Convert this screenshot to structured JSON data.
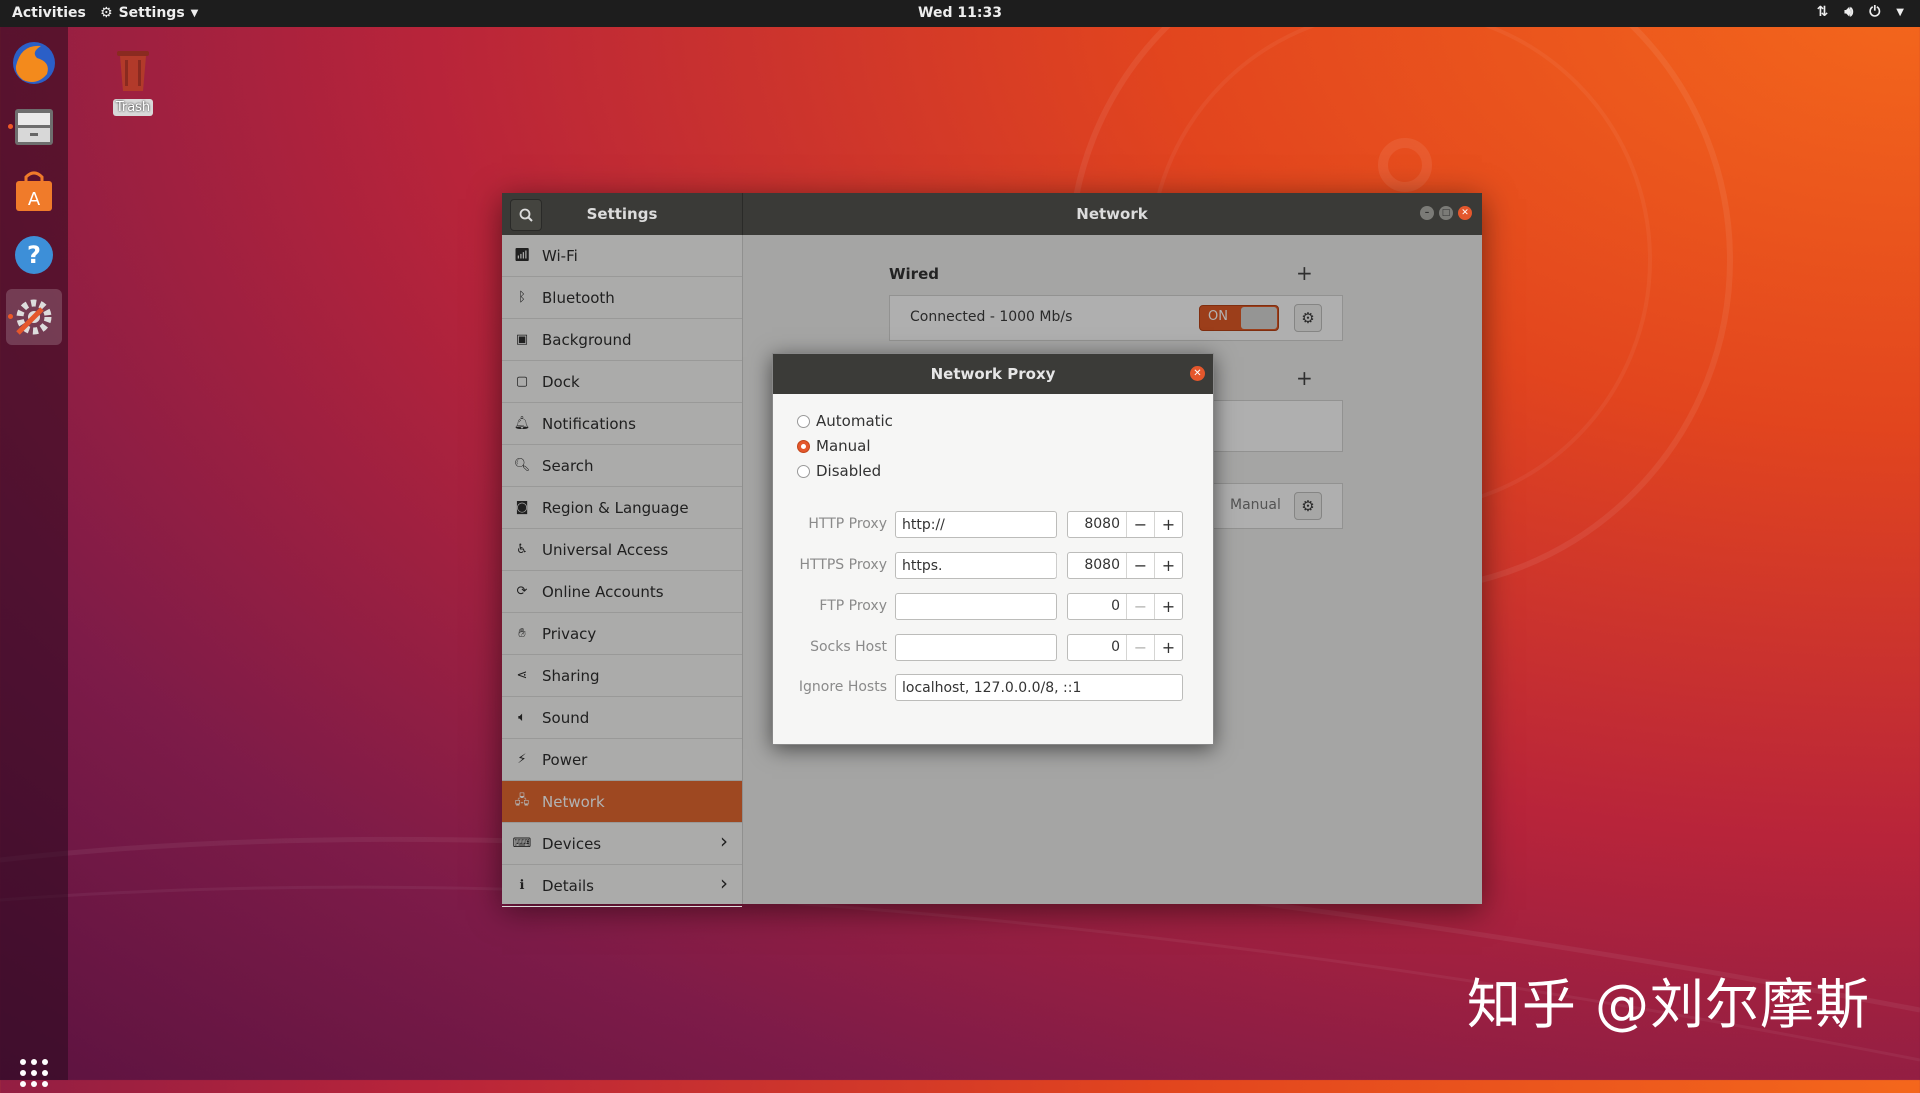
{
  "topbar": {
    "activities": "Activities",
    "app_menu": "Settings",
    "clock": "Wed 11:33"
  },
  "desktop": {
    "trash_label": "Trash"
  },
  "window": {
    "sidebar_title": "Settings",
    "panel_title": "Network"
  },
  "sidebar": {
    "items": [
      {
        "label": "Wi-Fi",
        "icon": "wifi-icon"
      },
      {
        "label": "Bluetooth",
        "icon": "bluetooth-icon"
      },
      {
        "label": "Background",
        "icon": "background-icon"
      },
      {
        "label": "Dock",
        "icon": "dock-icon"
      },
      {
        "label": "Notifications",
        "icon": "bell-icon"
      },
      {
        "label": "Search",
        "icon": "search-icon"
      },
      {
        "label": "Region & Language",
        "icon": "camera-icon"
      },
      {
        "label": "Universal Access",
        "icon": "accessibility-icon"
      },
      {
        "label": "Online Accounts",
        "icon": "online-accounts-icon"
      },
      {
        "label": "Privacy",
        "icon": "hand-icon"
      },
      {
        "label": "Sharing",
        "icon": "share-icon"
      },
      {
        "label": "Sound",
        "icon": "speaker-icon"
      },
      {
        "label": "Power",
        "icon": "power-plug-icon"
      },
      {
        "label": "Network",
        "icon": "network-icon",
        "selected": true
      },
      {
        "label": "Devices",
        "icon": "devices-icon",
        "chevron": true
      },
      {
        "label": "Details",
        "icon": "info-icon",
        "chevron": true
      }
    ]
  },
  "network": {
    "wired_heading": "Wired",
    "wired_status": "Connected - 1000 Mb/s",
    "toggle_label": "ON",
    "proxy_value": "Manual"
  },
  "proxy_dialog": {
    "title": "Network Proxy",
    "modes": [
      "Automatic",
      "Manual",
      "Disabled"
    ],
    "selected_mode": "Manual",
    "rows": [
      {
        "label": "HTTP Proxy",
        "value": "http://",
        "port": "8080"
      },
      {
        "label": "HTTPS Proxy",
        "value": "https.",
        "port": "8080"
      },
      {
        "label": "FTP Proxy",
        "value": "",
        "port": "0"
      },
      {
        "label": "Socks Host",
        "value": "",
        "port": "0"
      }
    ],
    "ignore_label": "Ignore Hosts",
    "ignore_value": "localhost, 127.0.0.0/8, ::1"
  },
  "watermark": "知乎 @刘尔摩斯",
  "colors": {
    "accent": "#e26730",
    "header": "#3a3a37",
    "close": "#e4572c"
  }
}
